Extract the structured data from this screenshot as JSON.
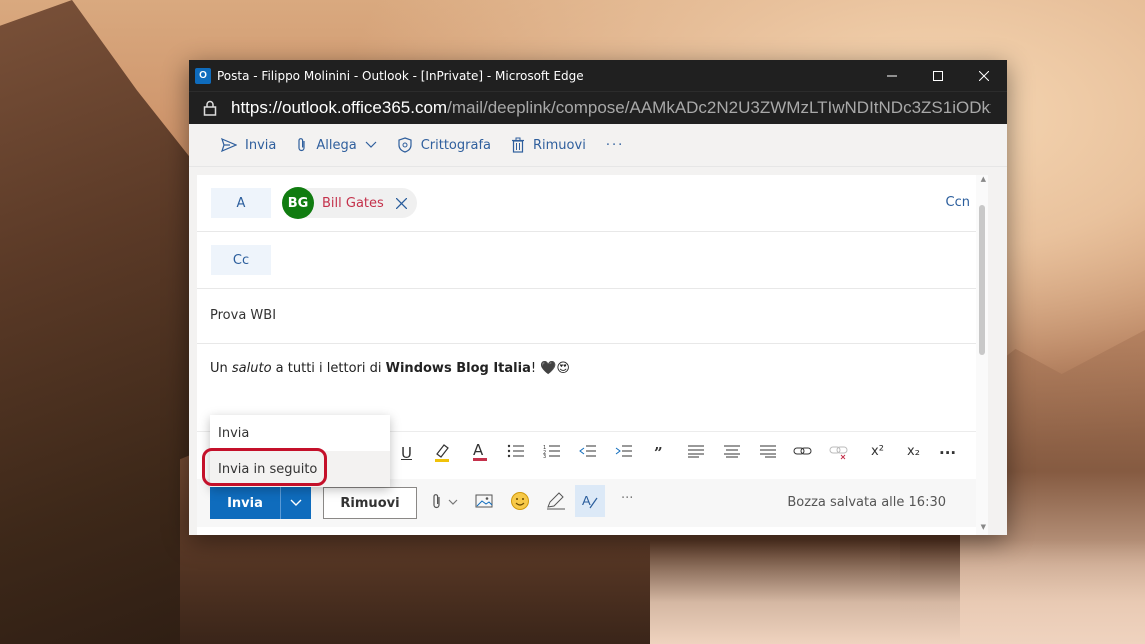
{
  "window": {
    "title": "Posta - Filippo Molinini - Outlook - [InPrivate] - Microsoft Edge",
    "app_icon": "outlook-icon",
    "controls": {
      "minimize": "—",
      "maximize": "☐",
      "close": "✕"
    }
  },
  "address": {
    "host": "https://outlook.office365.com",
    "path": "/mail/deeplink/compose/AAMkADc2N2U3ZWMzLTIwNDItNDc3ZS1iODkxLT..."
  },
  "toolbar": {
    "send": "Invia",
    "attach": "Allega",
    "encrypt": "Crittografa",
    "discard": "Rimuovi",
    "more": "···"
  },
  "compose": {
    "to_label": "A",
    "cc_label": "Cc",
    "bcc_label": "Ccn",
    "recipient": {
      "initials": "BG",
      "name": "Bill Gates",
      "avatar_color": "#107c10"
    },
    "subject": "Prova WBI",
    "body": {
      "p1": "Un ",
      "italic": "saluto",
      "p2": " a tutti i lettori di ",
      "bold": "Windows Blog Italia",
      "p3": "! ",
      "emoji_heart": "🖤",
      "emoji_face": "😍"
    }
  },
  "format": {
    "underline": "U",
    "font_color": "A",
    "quote": "”",
    "superscript": "x²",
    "subscript": "x₂",
    "more": "···"
  },
  "send_menu": {
    "items": [
      "Invia",
      "Invia in seguito"
    ]
  },
  "bottom": {
    "send": "Invia",
    "discard": "Rimuovi",
    "more": "···",
    "status": "Bozza salvata alle 16:30"
  },
  "colors": {
    "accent": "#0f6cbd",
    "highlight": "#c4102a"
  }
}
